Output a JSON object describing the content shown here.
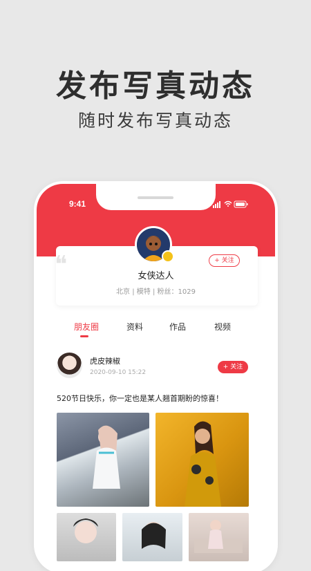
{
  "promo": {
    "title": "发布写真动态",
    "subtitle": "随时发布写真动态"
  },
  "status_bar": {
    "time": "9:41",
    "icons": [
      "signal-icon",
      "wifi-icon",
      "battery-icon"
    ]
  },
  "profile": {
    "nickname": "女侠达人",
    "meta": "北京 | 模特 | 粉丝：1029",
    "follow_label": "+ 关注"
  },
  "tabs": [
    {
      "label": "朋友圈",
      "active": true
    },
    {
      "label": "资料",
      "active": false
    },
    {
      "label": "作品",
      "active": false
    },
    {
      "label": "视频",
      "active": false
    }
  ],
  "post": {
    "author": "虎皮辣椒",
    "time": "2020-09-10 15:22",
    "follow_label": "+ 关注",
    "text": "520节日快乐，你一定也是某人翘首期盼的惊喜！"
  },
  "colors": {
    "accent": "#ee3a45",
    "background": "#e8e8e8"
  }
}
